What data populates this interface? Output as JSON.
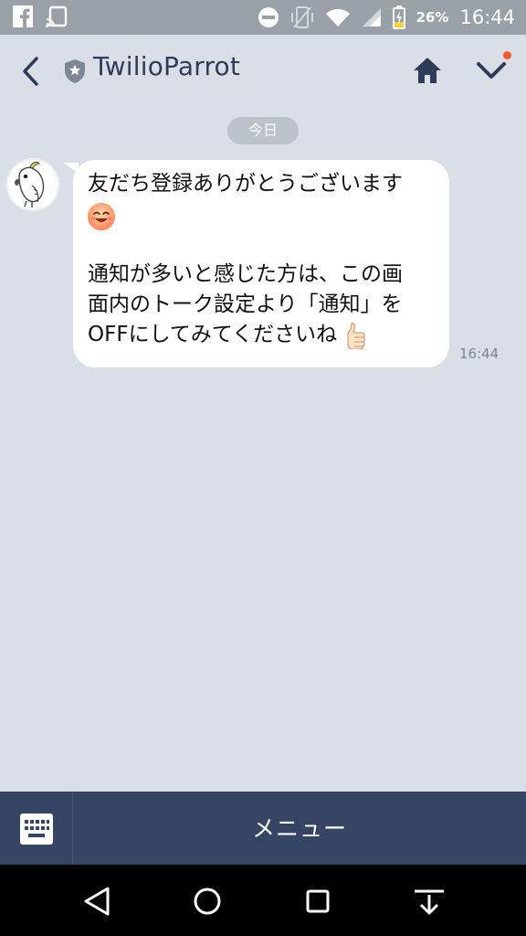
{
  "status_bar": {
    "battery": "26%",
    "time": "16:44",
    "icons": [
      "facebook-icon",
      "cast-icon",
      "dnd-icon",
      "vibrate-icon",
      "wifi-icon",
      "signal-icon",
      "battery-icon"
    ]
  },
  "header": {
    "title": "TwilioParrot",
    "icons": [
      "back-icon",
      "official-shield-icon",
      "home-icon",
      "chevron-down-icon"
    ],
    "accent": "#2f3b59",
    "notification_dot_color": "#f35a2f"
  },
  "chat": {
    "date_label": "今日",
    "messages": [
      {
        "sender_avatar": "cockatoo-avatar",
        "lines": [
          "友だち登録ありがとうございます",
          "",
          "",
          "通知が多いと感じた方は、この画",
          "面内のトーク設定より「通知」を",
          "OFFにしてみてくださいね"
        ],
        "emojis": [
          "smiling-face-emoji",
          "thumbs-up-emoji"
        ],
        "time": "16:44"
      }
    ]
  },
  "menu_bar": {
    "label": "メニュー",
    "icon": "keyboard-icon",
    "background": "#364563"
  },
  "nav_bar": {
    "icons": [
      "back-triangle-icon",
      "home-circle-icon",
      "recents-square-icon",
      "hide-keyboard-icon"
    ]
  }
}
